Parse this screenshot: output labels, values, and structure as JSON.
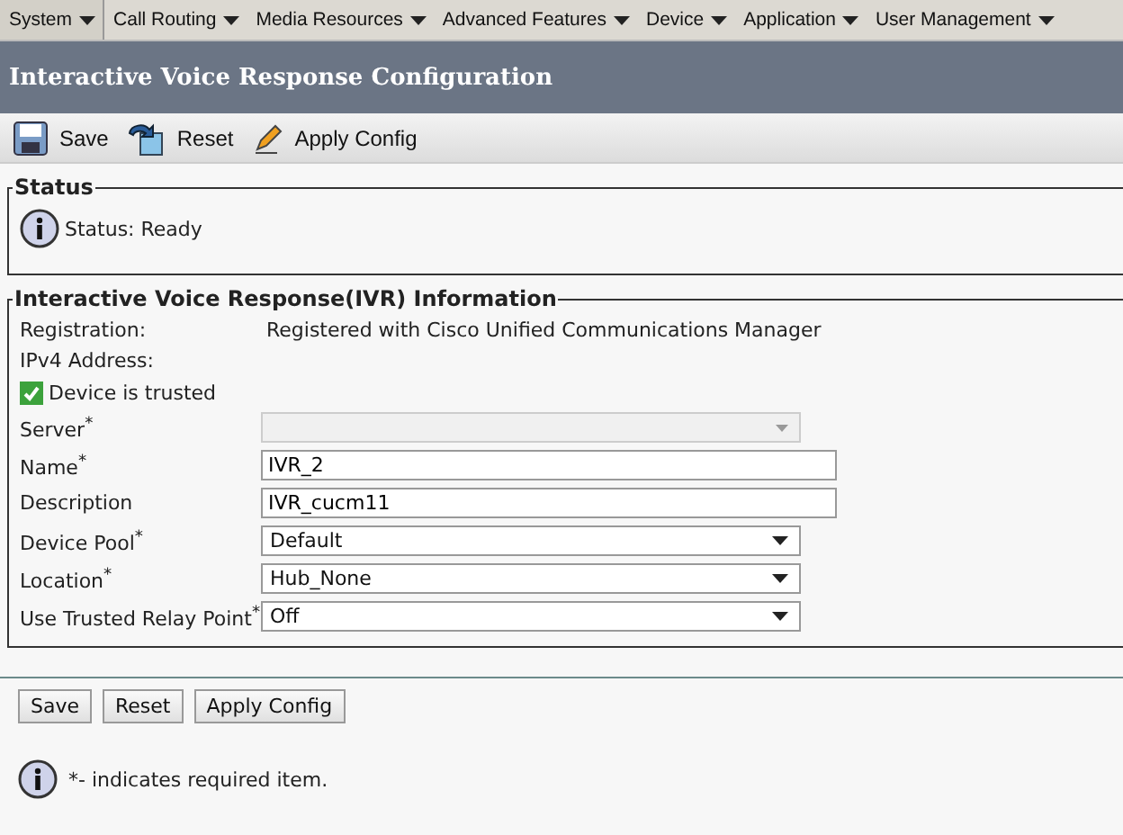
{
  "menu": [
    {
      "label": "System",
      "selected": true
    },
    {
      "label": "Call Routing",
      "selected": false
    },
    {
      "label": "Media Resources",
      "selected": false
    },
    {
      "label": "Advanced Features",
      "selected": false
    },
    {
      "label": "Device",
      "selected": false
    },
    {
      "label": "Application",
      "selected": false
    },
    {
      "label": "User Management",
      "selected": false
    }
  ],
  "page_title": "Interactive Voice Response Configuration",
  "toolbar": [
    {
      "kind": "save",
      "label": "Save"
    },
    {
      "kind": "reset",
      "label": "Reset"
    },
    {
      "kind": "apply",
      "label": "Apply Config"
    }
  ],
  "status": {
    "legend": "Status",
    "text": "Status: Ready"
  },
  "info": {
    "legend": "Interactive Voice Response(IVR) Information",
    "registration": {
      "label": "Registration:",
      "value": "Registered with Cisco Unified Communications Manager"
    },
    "ipv4": {
      "label": "IPv4 Address:"
    },
    "trusted": {
      "label": "Device is trusted",
      "checked": true
    },
    "fields": [
      {
        "kind": "select",
        "label": "Server$^{*}$",
        "disabled": true
      },
      {
        "kind": "text",
        "label": "Name$^{*}$",
        "value": "IVR_2",
        "disabled": false
      },
      {
        "kind": "text",
        "label": "Description",
        "value": "IVR_cucm11",
        "disabled": false
      },
      {
        "kind": "select",
        "label": "Device Pool$^{*}$",
        "value": "Default",
        "disabled": false
      },
      {
        "kind": "select",
        "label": "Location$^{*}$",
        "value": "Hub_None",
        "disabled": false
      },
      {
        "kind": "select",
        "label": "Use Trusted Relay Point$^{*}$",
        "value": "Off",
        "disabled": false
      }
    ]
  },
  "buttons": [
    "Save",
    "Reset",
    "Apply Config"
  ],
  "footnote": "*- indicates required item."
}
